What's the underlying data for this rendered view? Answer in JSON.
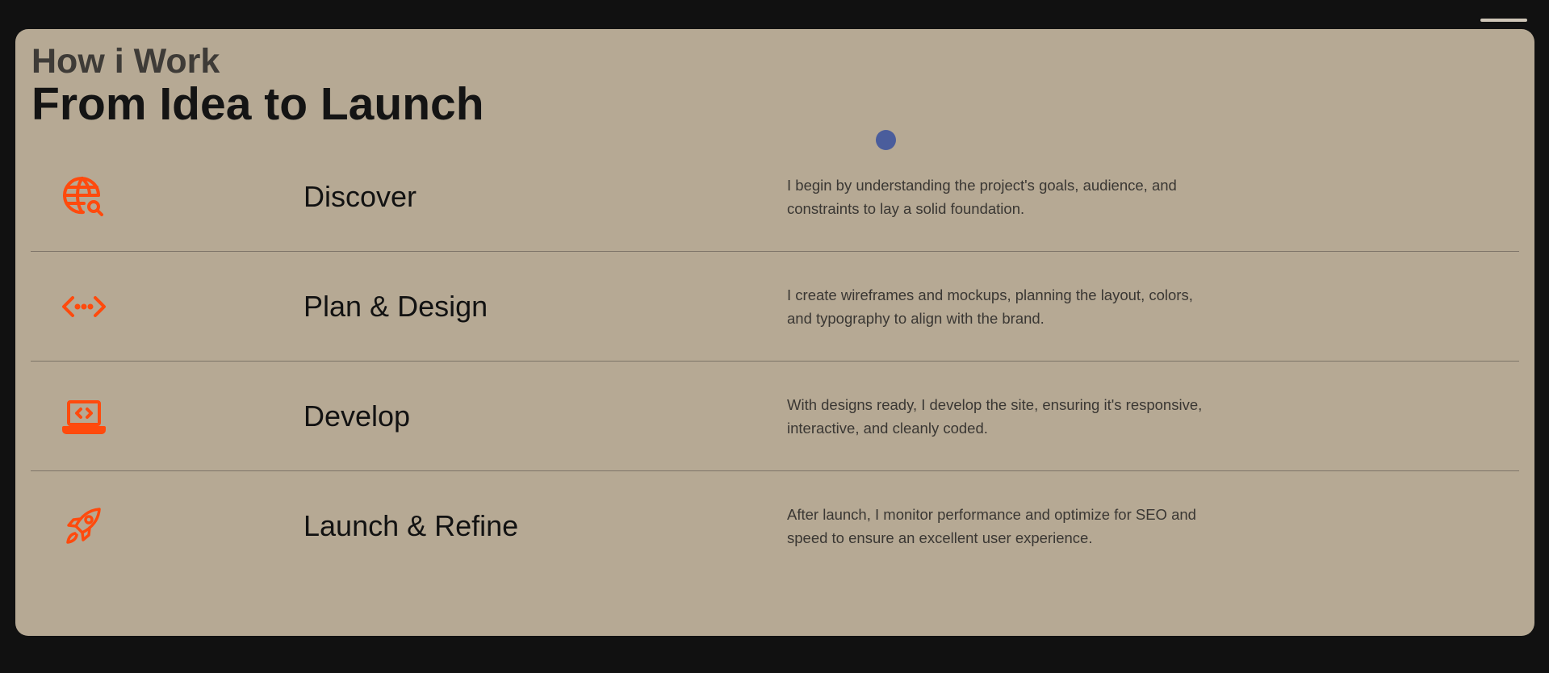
{
  "header": {
    "subtitle": "How i Work",
    "title": "From Idea to Launch"
  },
  "colors": {
    "accent": "#ff4a0d",
    "card_bg": "#b6a994",
    "page_bg": "#111111",
    "cursor": "#4a5d9c"
  },
  "steps": [
    {
      "icon": "globe-search-icon",
      "title": "Discover",
      "description": "I begin by understanding the project's goals, audience, and constraints to lay a solid foundation."
    },
    {
      "icon": "code-arrows-icon",
      "title": "Plan & Design",
      "description": "I create wireframes and mockups, planning the layout, colors, and typography to align with the brand."
    },
    {
      "icon": "laptop-code-icon",
      "title": "Develop",
      "description": "With designs ready, I develop the site, ensuring it's responsive, interactive, and cleanly coded."
    },
    {
      "icon": "rocket-icon",
      "title": "Launch & Refine",
      "description": "After launch, I monitor performance and optimize for SEO and speed to ensure an excellent user experience."
    }
  ]
}
